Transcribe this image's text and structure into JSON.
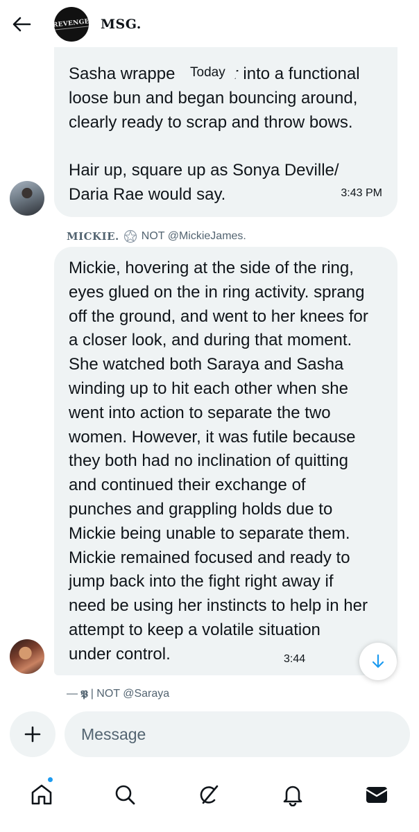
{
  "header": {
    "group_name": "MSG.",
    "avatar_logo_text": "REVENGE",
    "icons": {
      "back": "arrow-left-icon"
    }
  },
  "date_separator": "Today",
  "messages": [
    {
      "text": "Sasha wrapped her hair into a functional loose bun and began bouncing around, clearly ready to scrap and throw bows.\n\nHair up, square up as Sonya Deville/ Daria Rae would say.",
      "text_visible_part1": "Sasha wrappe",
      "text_visible_part1b": "ir into a functional",
      "text_rest": "loose bun and began bouncing around,\nclearly ready to scrap and throw bows.\n\nHair up, square up as Sonya Deville/\nDaria Rae would say.",
      "time": "3:43 PM"
    },
    {
      "sender_name": "MICKIE.",
      "sender_note": "NOT @MickieJames.",
      "text": "Mickie, hovering at the side of the ring,\neyes glued on the in ring activity. sprang\noff the ground, and went to her knees for\na closer look, and during that moment.\nShe watched both Saraya and Sasha\nwinding up to hit each other when she\nwent into action to separate the two\nwomen. However, it was futile because\nthey both had no inclination of quitting\nand continued their exchange of\npunches and grappling holds due to\nMickie being unable to separate them.\nMickie remained focused and ready to\njump back into the fight right away if\nneed be using her instincts to help in her\nattempt to keep a volatile situation\nunder control.",
      "time": "3:44"
    }
  ],
  "next_sender": {
    "prefix": "—",
    "glyph": "𝕻",
    "note": "| NOT @Saraya"
  },
  "composer": {
    "placeholder": "Message"
  },
  "colors": {
    "accent": "#1d9bf0",
    "bubble": "#eff3f4",
    "text": "#0f1419",
    "muted": "#536471"
  },
  "nav": {
    "items": [
      "home-icon",
      "search-icon",
      "grok-icon",
      "notifications-icon",
      "messages-icon"
    ],
    "home_has_notification": true
  }
}
